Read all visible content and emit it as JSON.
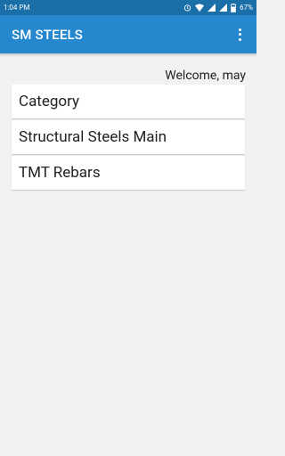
{
  "status_bar": {
    "time": "1:04 PM",
    "battery": "67%"
  },
  "app_bar": {
    "title": "SM STEELS"
  },
  "welcome_text": "Welcome, may",
  "list": {
    "items": [
      {
        "label": "Category"
      },
      {
        "label": "Structural Steels Main"
      },
      {
        "label": "TMT Rebars"
      }
    ]
  }
}
